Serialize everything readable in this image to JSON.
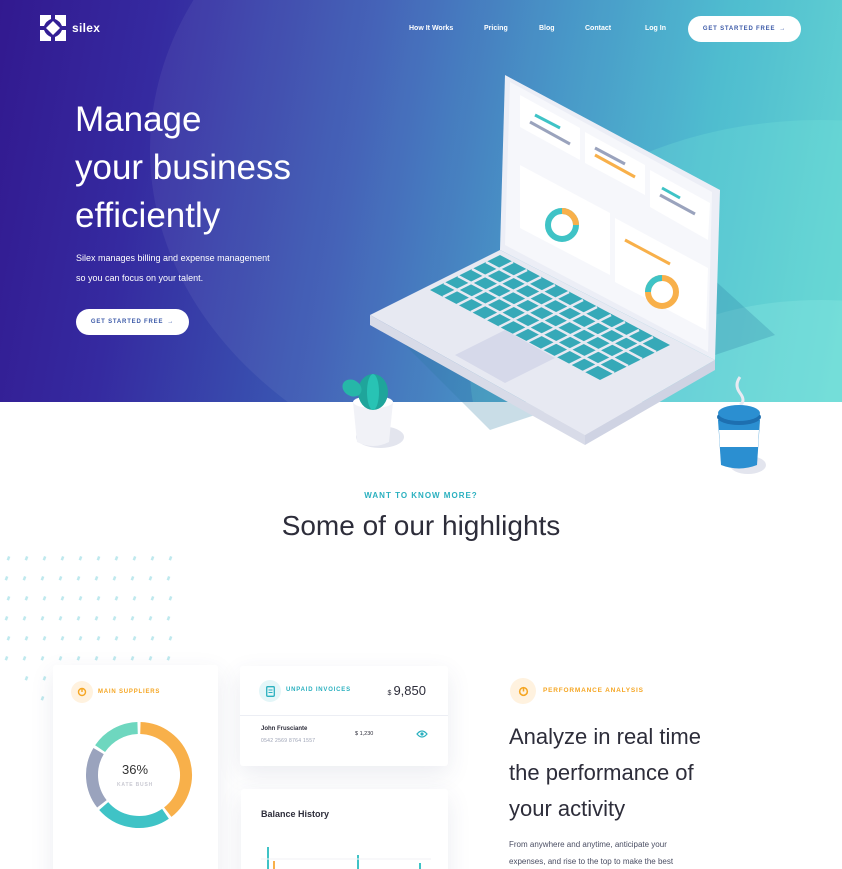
{
  "brand": {
    "name": "silex"
  },
  "nav": {
    "links": [
      "How It Works",
      "Pricing",
      "Blog",
      "Contact",
      "Log In"
    ],
    "cta": "GET STARTED FREE"
  },
  "hero": {
    "title_lines": [
      "Manage",
      "your business",
      "efficiently"
    ],
    "subtitle_lines": [
      "Silex manages billing and expense management",
      "so you can focus on your talent."
    ],
    "cta": "GET STARTED FREE"
  },
  "highlights": {
    "eyebrow": "WANT TO KNOW MORE?",
    "title": "Some of our highlights"
  },
  "suppliers_card": {
    "label": "MAIN SUPPLIERS",
    "percent": "36%",
    "name": "KATE BUSH",
    "segments": [
      {
        "color": "#f8b04a",
        "share": 0.4
      },
      {
        "color": "#3fc3c6",
        "share": 0.24
      },
      {
        "color": "#9aa3bd",
        "share": 0.2
      },
      {
        "color": "#6ed7bf",
        "share": 0.16
      }
    ]
  },
  "invoices_card": {
    "label": "UNPAID INVOICES",
    "currency": "$",
    "amount": "9,850",
    "row": {
      "name": "John Frusciante",
      "phone": "0542 2569 8764 1557",
      "sum": "$ 1,230"
    }
  },
  "balance_card": {
    "title": "Balance History"
  },
  "performance": {
    "label": "PERFORMANCE ANALYSIS",
    "title_lines": [
      "Analyze in real time",
      "the performance of",
      "your activity"
    ],
    "desc_lines": [
      "From anywhere and anytime, anticipate your",
      "expenses, and rise to the top to make the best"
    ]
  },
  "colors": {
    "accent_teal": "#2ab0bf",
    "accent_orange": "#f5a623",
    "cta_text": "#3c5aa8",
    "hero_start": "#32198f",
    "hero_end": "#5cd3d1"
  }
}
